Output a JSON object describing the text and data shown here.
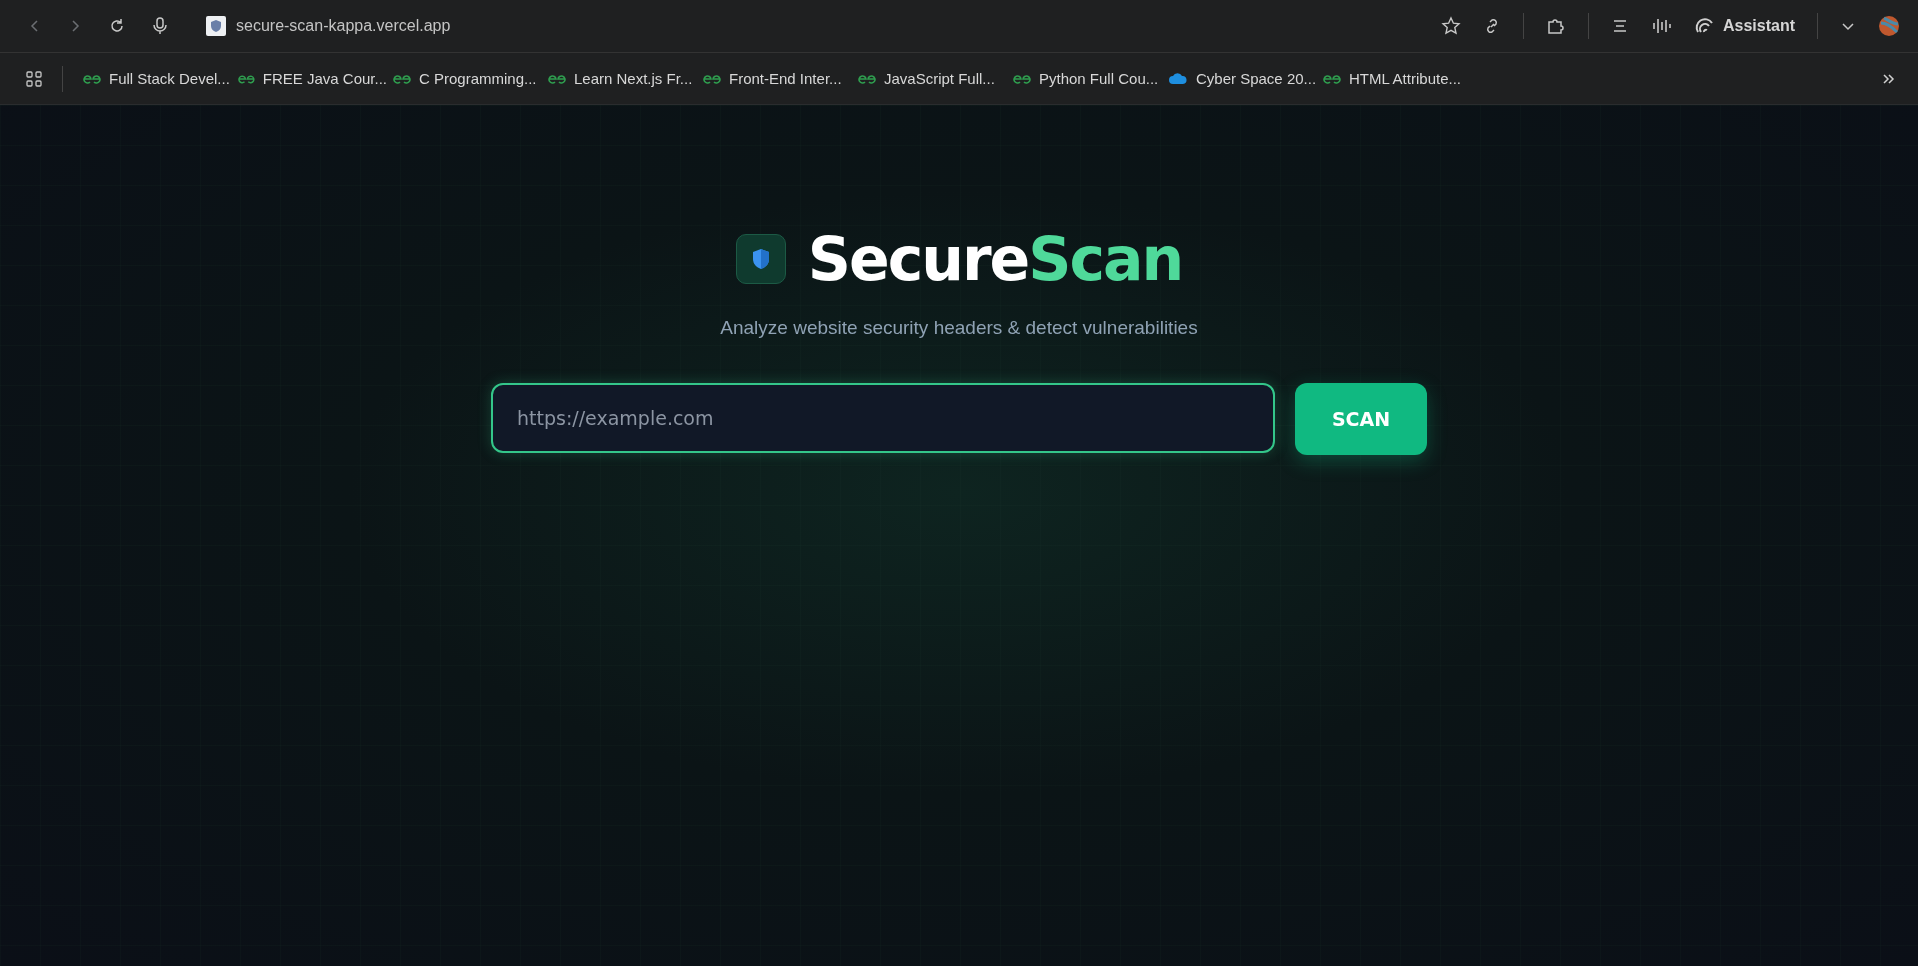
{
  "browser": {
    "address": "secure-scan-kappa.vercel.app",
    "assistant_label": "Assistant",
    "bookmarks": [
      {
        "kind": "gfg",
        "label": "Full Stack Devel..."
      },
      {
        "kind": "gfg",
        "label": "FREE Java Cour..."
      },
      {
        "kind": "gfg",
        "label": "C Programming..."
      },
      {
        "kind": "gfg",
        "label": "Learn Next.js Fr..."
      },
      {
        "kind": "gfg",
        "label": "Front-End Inter..."
      },
      {
        "kind": "gfg",
        "label": "JavaScript Full..."
      },
      {
        "kind": "gfg",
        "label": "Python Full Cou..."
      },
      {
        "kind": "cloud",
        "label": "Cyber Space 20..."
      },
      {
        "kind": "gfg",
        "label": "HTML Attribute..."
      }
    ]
  },
  "app": {
    "title_main": "Secure",
    "title_accent": "Scan",
    "subtitle": "Analyze website security headers & detect vulnerabilities",
    "url_field": {
      "placeholder": "https://example.com"
    },
    "scan_button": "SCAN"
  }
}
